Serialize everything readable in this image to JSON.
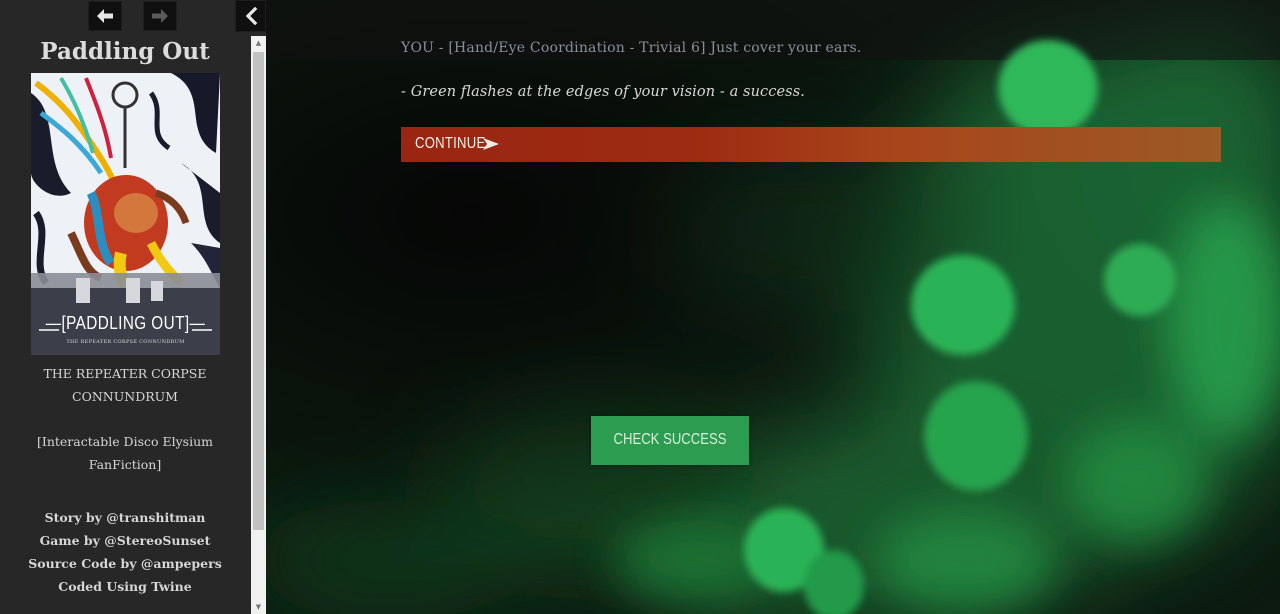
{
  "navigation": {
    "back_icon": "arrow-left-icon",
    "forward_icon": "arrow-right-icon",
    "collapse_icon": "chevron-left-icon"
  },
  "sidebar": {
    "title": "Paddling Out",
    "cover": {
      "title_text": "—[PADDLING OUT]—",
      "subtitle_text": "THE REPEATER CORPSE CONNUNDRUM"
    },
    "subtitle_lines": [
      "THE REPEATER CORPSE",
      "CONNUNDRUM"
    ],
    "genre_lines": [
      "[Interactable Disco Elysium",
      "FanFiction]"
    ],
    "credits": [
      "Story by @transhitman",
      "Game by @StereoSunset",
      "Source Code by @ampepers",
      "Coded Using Twine"
    ]
  },
  "passage": {
    "dialogue": "YOU - [Hand/Eye Coordination - Trivial 6] Just cover your ears.",
    "narration": "- Green flashes at the edges of your vision - a success.",
    "continue_label": "CONTINUE",
    "continue_icon": "play-arrow-icon",
    "check_label": "CHECK SUCCESS"
  },
  "colors": {
    "continue_button": "#9a2612",
    "check_button": "#2c9c50",
    "sidebar_bg": "#272727",
    "main_bg": "#101010"
  }
}
